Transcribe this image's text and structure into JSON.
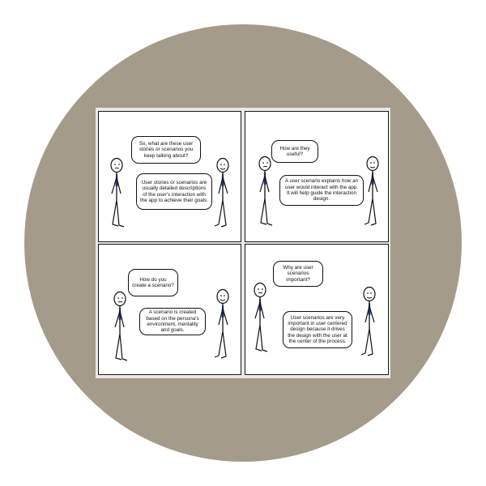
{
  "panels": [
    {
      "speech_top": "So, what are these user stories or scenarios you keep talking about?",
      "speech_bottom": "User stories or scenarios are usually detailed descriptions of the user's interaction with the app to achieve their goals."
    },
    {
      "speech_top": "How are they useful?",
      "speech_bottom": "A user scenario explains how an user would interact with the app. It will help guide the interaction design."
    },
    {
      "speech_top": "How do you create a scenario?",
      "speech_bottom": "A scenario is created based on the persona's environment, mentality and goals."
    },
    {
      "speech_top": "Why are user scenarios important?",
      "speech_bottom": "User scenarios are very important in user centered design because it drives the design with the user at the center of the process."
    }
  ],
  "colors": {
    "circle_background": "#a59b8a",
    "panel_border": "#1a1a1a",
    "tie": "#1d2f6b"
  },
  "icons": [
    "stick-figure-icon",
    "speech-bubble-icon"
  ]
}
